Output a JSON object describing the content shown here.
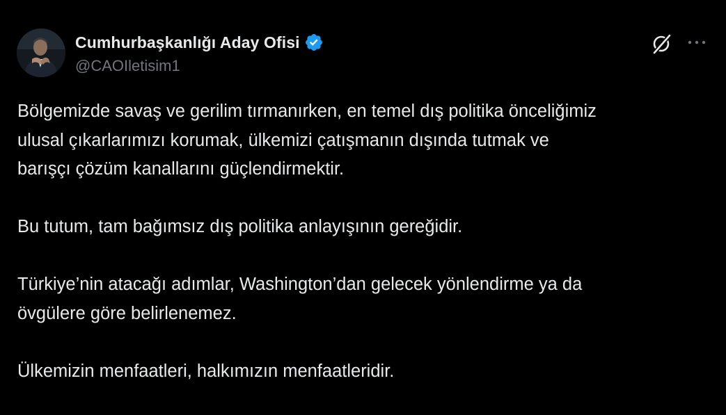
{
  "author": {
    "display_name": "Cumhurbaşkanlığı Aday Ofisi",
    "handle": "@CAOIletisim1",
    "verified": true,
    "verified_icon": "verified-badge-icon",
    "avatar_icon": "profile-avatar"
  },
  "actions": {
    "grok_icon": "grok-icon",
    "more_icon": "more-dots-icon"
  },
  "post": {
    "paragraphs": [
      "Bölgemizde savaş ve gerilim tırmanırken, en temel dış politika önceliğimiz\nulusal çıkarlarımızı korumak, ülkemizi çatışmanın dışında tutmak ve\nbarışçı çözüm kanallarını güçlendirmektir.",
      "Bu tutum, tam bağımsız dış politika anlayışının gereğidir.",
      "Türkiye’nin atacağı adımlar, Washington’dan gelecek yönlendirme ya da\növgülere göre belirlenemez.",
      "Ülkemizin menfaatleri, halkımızın menfaatleridir."
    ]
  },
  "colors": {
    "background": "#000000",
    "text_primary": "#e7e9ea",
    "text_secondary": "#71767b",
    "verified_blue": "#1d9bf0"
  }
}
